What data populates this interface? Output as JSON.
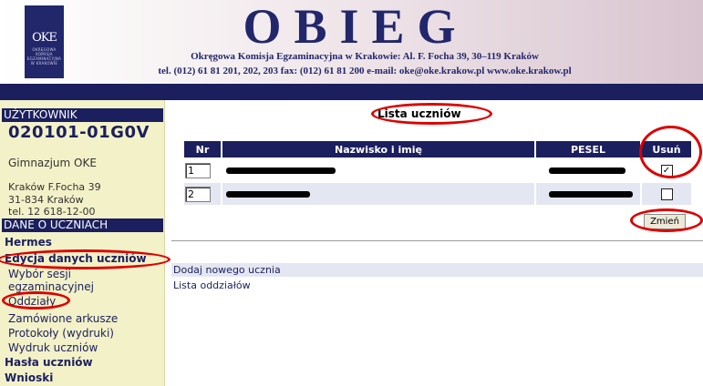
{
  "header": {
    "logo_glyph": "OKE",
    "logo_small": "OKRĘGOWA KOMISJA EGZAMINACYJNA W KRAKOWIE",
    "title": "OBIEG",
    "org_line": "Okręgowa Komisja Egzaminacyjna w Krakowie:  Al. F. Focha 39, 30–119 Kraków",
    "contact_line": "tel. (012) 61 81 201, 202, 203  fax: (012) 61 81 200  e-mail: oke@oke.krakow.pl   www.oke.krakow.pl"
  },
  "sidebar": {
    "user_heading": "UŻYTKOWNIK",
    "user_code": "020101-01G0V",
    "school_name": "Gimnazjum OKE",
    "address_1": "Kraków F.Focha 39",
    "address_2": "31-834 Kraków",
    "phone": "tel. 12 618-12-00",
    "section_heading": "DANE O UCZNIACH",
    "items": [
      {
        "label": "Hermes"
      },
      {
        "label": "Edycja danych uczniów"
      },
      {
        "label": "Wybór sesji"
      },
      {
        "label": "egzaminacyjnej"
      },
      {
        "label": "Oddziały"
      },
      {
        "label": "Zamówione arkusze"
      },
      {
        "label": "Protokoły (wydruki)"
      },
      {
        "label": "Wydruk uczniów"
      },
      {
        "label": "Hasła uczniów"
      },
      {
        "label": "Wnioski"
      }
    ]
  },
  "main": {
    "title": "Lista uczniów",
    "table": {
      "headers": [
        "Nr",
        "Nazwisko i imię",
        "PESEL",
        "Usuń"
      ],
      "rows": [
        {
          "nr": "1",
          "delete_checked": true
        },
        {
          "nr": "2",
          "delete_checked": false
        }
      ]
    },
    "submit_label": "Zmień",
    "links": [
      "Dodaj nowego ucznia",
      "Lista oddziałów"
    ]
  },
  "colors": {
    "navy": "#1b1f5e",
    "sidebar_bg": "#f3f1c8",
    "highlight_red": "#dd0000"
  }
}
